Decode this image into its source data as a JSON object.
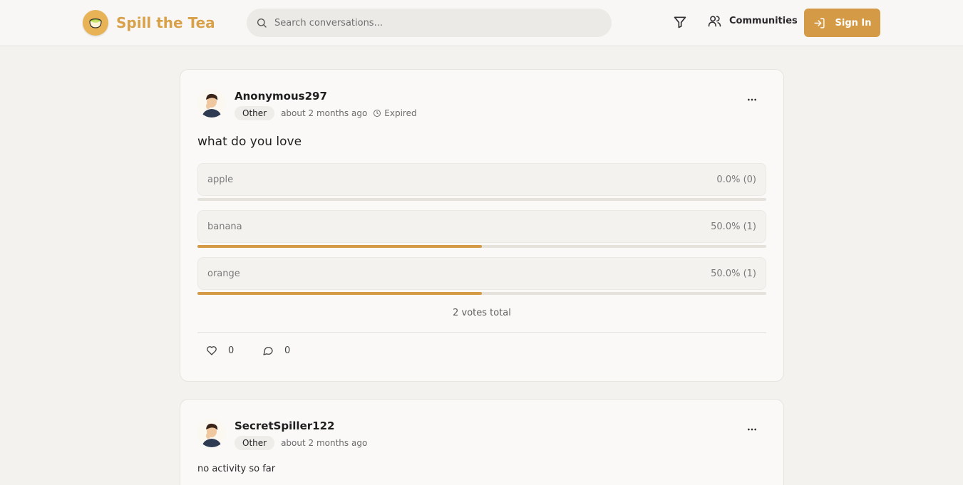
{
  "header": {
    "brand": "Spill the Tea",
    "search_placeholder": "Search conversations...",
    "communities_label": "Communities",
    "signin_label": "Sign In",
    "accent_color": "#d49a46"
  },
  "posts": [
    {
      "username": "Anonymous297",
      "category": "Other",
      "time": "about 2 months ago",
      "status": "Expired",
      "question": "what do you love",
      "options": [
        {
          "label": "apple",
          "stat": "0.0% (0)",
          "percent": 0
        },
        {
          "label": "banana",
          "stat": "50.0% (1)",
          "percent": 50
        },
        {
          "label": "orange",
          "stat": "50.0% (1)",
          "percent": 50
        }
      ],
      "total": "2 votes total",
      "likes": "0",
      "comments": "0"
    },
    {
      "username": "SecretSpiller122",
      "category": "Other",
      "time": "about 2 months ago",
      "body": "no activity so far"
    }
  ]
}
